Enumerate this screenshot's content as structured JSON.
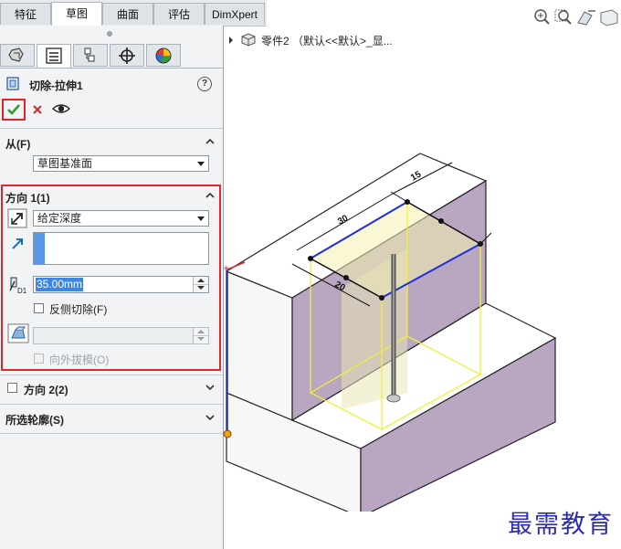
{
  "tabs": [
    {
      "label": "特征",
      "active": false
    },
    {
      "label": "草图",
      "active": true
    },
    {
      "label": "曲面",
      "active": false
    },
    {
      "label": "评估",
      "active": false
    },
    {
      "label": "DimXpert",
      "active": false
    }
  ],
  "panel_tabs": [
    "feature-manager-icon",
    "property-manager-icon",
    "configuration-manager-icon",
    "dimxpert-manager-icon",
    "display-manager-icon"
  ],
  "feature": {
    "title": "切除-拉伸1",
    "help_label": "?"
  },
  "from_section": {
    "title": "从(F)",
    "value": "草图基准面"
  },
  "direction1": {
    "title": "方向 1(1)",
    "end_condition": "给定深度",
    "depth": "35.00mm",
    "depth_icon_label": "D1",
    "flip_side_label": "反侧切除(F)",
    "draft_outward_label": "向外拔模(O)"
  },
  "direction2": {
    "title": "方向 2(2)"
  },
  "selected_contours": {
    "title": "所选轮廓(S)"
  },
  "tree": {
    "label": "零件2 （默认<<默认>_显..."
  },
  "dimensions": {
    "d1": "15",
    "d2": "30",
    "d3": "20"
  },
  "watermark": "最需教育",
  "colors": {
    "accent_red": "#e0252b",
    "sketch_blue": "#1f2fd8",
    "preview_yellow": "#f2ef3a",
    "face_purple": "#b9a7c2"
  }
}
